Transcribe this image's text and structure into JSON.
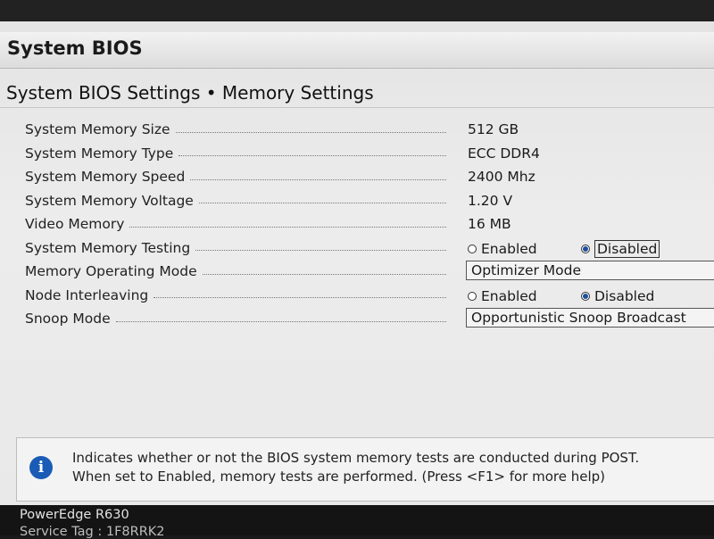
{
  "window": {
    "title": "System BIOS"
  },
  "page": {
    "title": "System BIOS Settings • Memory Settings"
  },
  "settings": [
    {
      "label": "System Memory Size",
      "value": "512 GB"
    },
    {
      "label": "System Memory Type",
      "value": "ECC DDR4"
    },
    {
      "label": "System Memory Speed",
      "value": "2400 Mhz"
    },
    {
      "label": "System Memory Voltage",
      "value": "1.20 V"
    },
    {
      "label": "Video Memory",
      "value": "16 MB"
    },
    {
      "label": "System Memory Testing",
      "options": [
        "Enabled",
        "Disabled"
      ],
      "selected": "Disabled"
    },
    {
      "label": "Memory Operating Mode",
      "value": "Optimizer Mode"
    },
    {
      "label": "Node Interleaving",
      "options": [
        "Enabled",
        "Disabled"
      ],
      "selected": "Disabled"
    },
    {
      "label": "Snoop Mode",
      "value": "Opportunistic Snoop Broadcast"
    }
  ],
  "help": {
    "icon": "info-icon",
    "line1": "Indicates whether or not the BIOS system memory tests are conducted during POST.",
    "line2": "When set to Enabled, memory tests are performed. (Press <F1> for more help)"
  },
  "footer": {
    "model": "PowerEdge R630",
    "service_tag": "Service Tag : 1F8RRK2"
  },
  "colors": {
    "accent": "#1a5bb5",
    "background": "#e9e9e9",
    "footer": "#141414"
  }
}
